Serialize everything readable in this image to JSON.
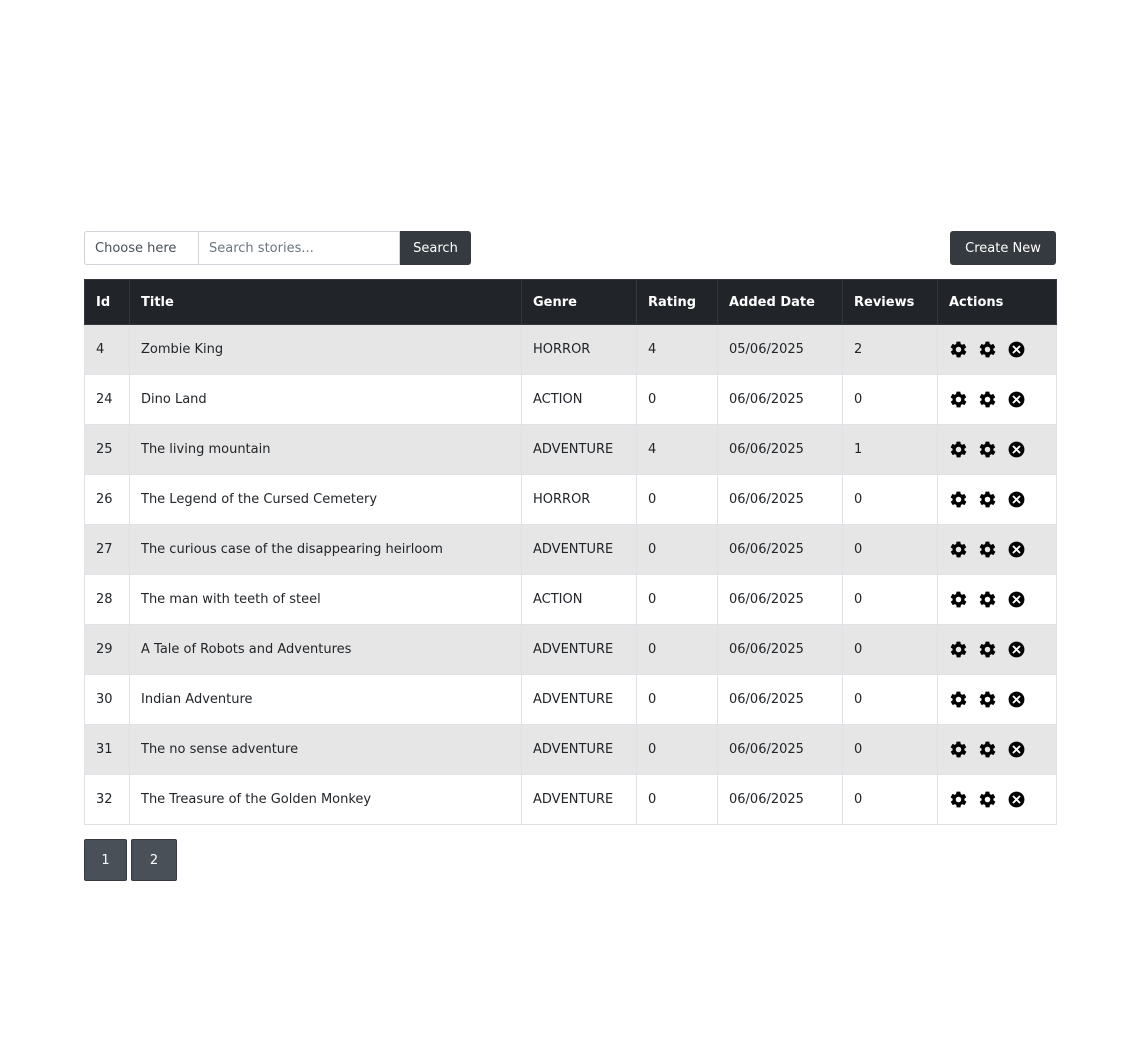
{
  "toolbar": {
    "select_label": "Choose here",
    "search_placeholder": "Search stories...",
    "search_button": "Search",
    "create_button": "Create New"
  },
  "table": {
    "headers": [
      "Id",
      "Title",
      "Genre",
      "Rating",
      "Added Date",
      "Reviews",
      "Actions"
    ],
    "rows": [
      {
        "id": "4",
        "title": "Zombie King",
        "genre": "HORROR",
        "rating": "4",
        "date": "05/06/2025",
        "reviews": "2"
      },
      {
        "id": "24",
        "title": "Dino Land",
        "genre": "ACTION",
        "rating": "0",
        "date": "06/06/2025",
        "reviews": "0"
      },
      {
        "id": "25",
        "title": "The living mountain",
        "genre": "ADVENTURE",
        "rating": "4",
        "date": "06/06/2025",
        "reviews": "1"
      },
      {
        "id": "26",
        "title": "The Legend of the Cursed Cemetery",
        "genre": "HORROR",
        "rating": "0",
        "date": "06/06/2025",
        "reviews": "0"
      },
      {
        "id": "27",
        "title": "The curious case of the disappearing heirloom",
        "genre": "ADVENTURE",
        "rating": "0",
        "date": "06/06/2025",
        "reviews": "0"
      },
      {
        "id": "28",
        "title": "The man with teeth of steel",
        "genre": "ACTION",
        "rating": "0",
        "date": "06/06/2025",
        "reviews": "0"
      },
      {
        "id": "29",
        "title": "A Tale of Robots and Adventures",
        "genre": "ADVENTURE",
        "rating": "0",
        "date": "06/06/2025",
        "reviews": "0"
      },
      {
        "id": "30",
        "title": "Indian Adventure",
        "genre": "ADVENTURE",
        "rating": "0",
        "date": "06/06/2025",
        "reviews": "0"
      },
      {
        "id": "31",
        "title": "The no sense adventure",
        "genre": "ADVENTURE",
        "rating": "0",
        "date": "06/06/2025",
        "reviews": "0"
      },
      {
        "id": "32",
        "title": "The Treasure of the Golden Monkey",
        "genre": "ADVENTURE",
        "rating": "0",
        "date": "06/06/2025",
        "reviews": "0"
      }
    ],
    "action_icons": [
      "gear-icon",
      "gear-icon",
      "close-circle-icon"
    ]
  },
  "pagination": {
    "pages": [
      "1",
      "2"
    ]
  },
  "colors": {
    "header_bg": "#212529",
    "button_bg": "#343a40",
    "striped_row": "#e6e6e6",
    "page_button": "#495057"
  }
}
